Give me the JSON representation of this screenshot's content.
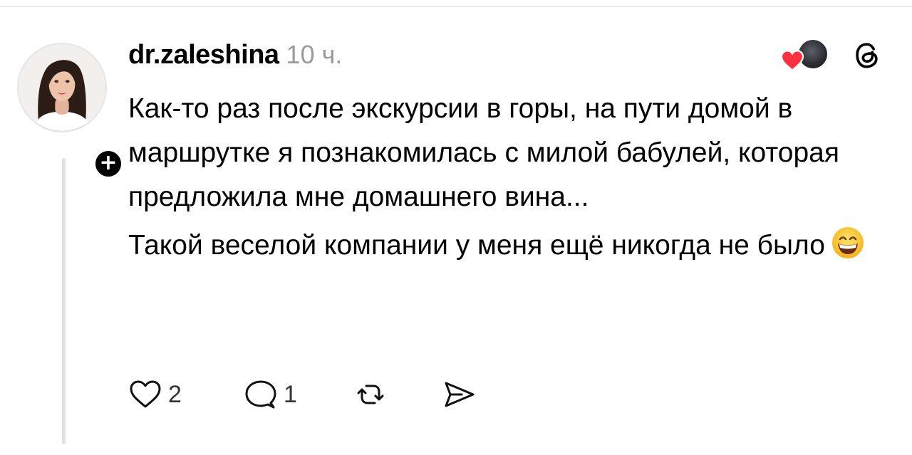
{
  "post": {
    "username": "dr.zaleshina",
    "time": "10 ч.",
    "paragraphs": [
      "Как-то раз после экскурсии в горы, на пути домой в маршрутке я познакомилась с милой бабулей, которая предложила мне домашнего вина...",
      "Такой веселой компании у меня ещё никогда не было"
    ],
    "emoji": "grinning-face-smiling-eyes"
  },
  "actions": {
    "likes": "2",
    "replies": "1"
  },
  "icons": {
    "follow": "plus-icon",
    "like": "heart-icon",
    "reply": "comment-icon",
    "repost": "repost-icon",
    "share": "send-icon",
    "app": "threads-logo"
  },
  "colors": {
    "heart_accent": "#ff3040",
    "muted_text": "#9a9a9a",
    "thread_line": "#e1e1e1"
  }
}
